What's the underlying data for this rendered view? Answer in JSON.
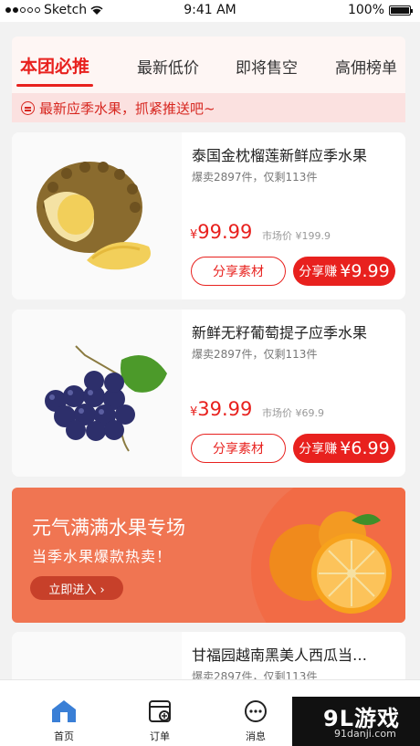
{
  "status": {
    "carrier": "Sketch",
    "time": "9:41 AM",
    "battery": "100%",
    "battery_level": 1.0
  },
  "tabs": [
    {
      "label": "本团必推",
      "active": true
    },
    {
      "label": "最新低价"
    },
    {
      "label": "即将售空"
    },
    {
      "label": "高佣榜单"
    }
  ],
  "notice": "最新应季水果，抓紧推送吧~",
  "products": [
    {
      "title": "泰国金枕榴莲新鲜应季水果",
      "sold": "爆卖2897件，仅剩113件",
      "price": "99.99",
      "currency": "¥",
      "market": "市场价 ¥199.9",
      "share": "分享素材",
      "earn_label": "分享赚",
      "earn_value": "¥9.99"
    },
    {
      "title": "新鲜无籽葡萄提子应季水果",
      "sold": "爆卖2897件，仅剩113件",
      "price": "39.99",
      "currency": "¥",
      "market": "市场价 ¥69.9",
      "share": "分享素材",
      "earn_label": "分享赚",
      "earn_value": "¥6.99"
    },
    {
      "title": "甘福园越南黑美人西瓜当…",
      "sold": "爆卖2897件，仅剩113件"
    }
  ],
  "banner": {
    "title": "元气满满水果专场",
    "subtitle": "当季水果爆款热卖！",
    "button": "立即进入 ›"
  },
  "tabbar": [
    {
      "label": "首页",
      "icon": "home-icon"
    },
    {
      "label": "订单",
      "icon": "order-icon"
    },
    {
      "label": "消息",
      "icon": "message-icon"
    }
  ],
  "watermark": {
    "main": "9L游戏",
    "sub": "91danji.com"
  },
  "colors": {
    "accent": "#e8211e",
    "banner": "#f07552"
  }
}
